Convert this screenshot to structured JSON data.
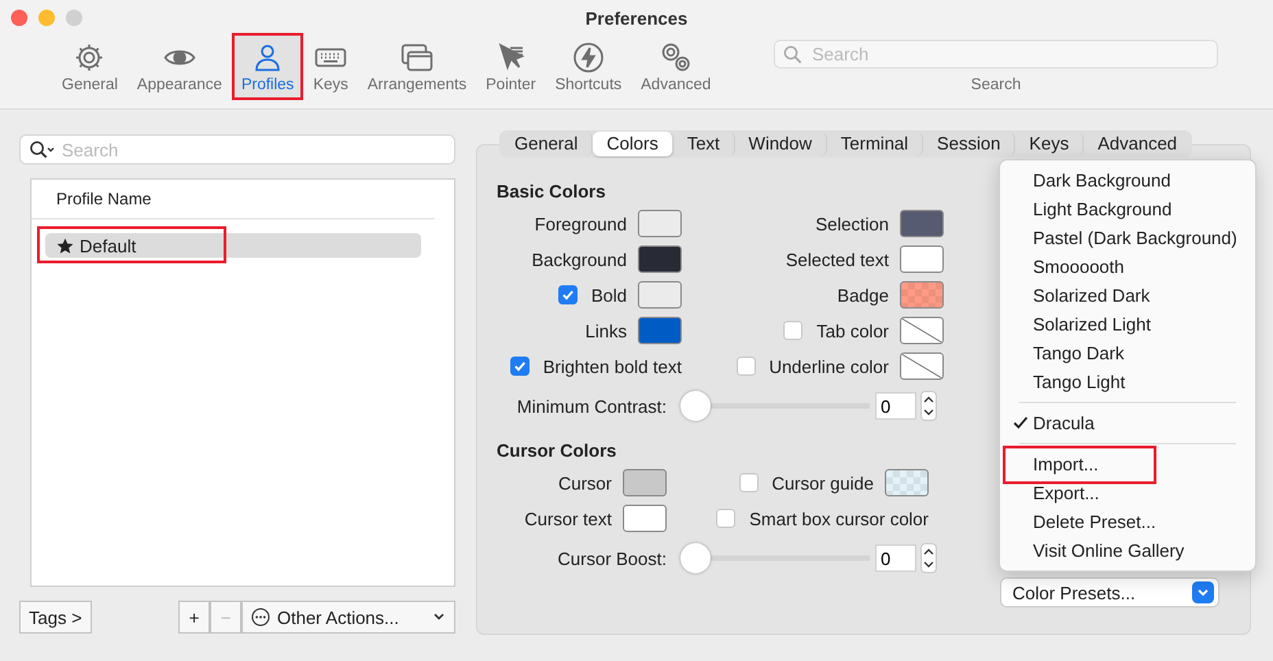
{
  "window": {
    "title": "Preferences"
  },
  "toolbar": [
    {
      "label": "General",
      "selected": false,
      "annotated": false
    },
    {
      "label": "Appearance",
      "selected": false,
      "annotated": false
    },
    {
      "label": "Profiles",
      "selected": true,
      "annotated": true
    },
    {
      "label": "Keys",
      "selected": false,
      "annotated": false
    },
    {
      "label": "Arrangements",
      "selected": false,
      "annotated": false
    },
    {
      "label": "Pointer",
      "selected": false,
      "annotated": false
    },
    {
      "label": "Shortcuts",
      "selected": false,
      "annotated": false
    },
    {
      "label": "Advanced",
      "selected": false,
      "annotated": false
    }
  ],
  "toolbar_search": {
    "placeholder": "Search",
    "label": "Search"
  },
  "profiles": {
    "search": {
      "placeholder": "Search"
    },
    "column": "Profile Name",
    "rows": [
      {
        "label": "Default",
        "is_default": true,
        "selected": true,
        "annotated": true
      }
    ],
    "tags_button": "Tags >",
    "add_button": "+",
    "remove_button": "−",
    "other_actions": "Other Actions..."
  },
  "tabs": [
    {
      "label": "General",
      "selected": false
    },
    {
      "label": "Colors",
      "selected": true
    },
    {
      "label": "Text",
      "selected": false
    },
    {
      "label": "Window",
      "selected": false
    },
    {
      "label": "Terminal",
      "selected": false
    },
    {
      "label": "Session",
      "selected": false
    },
    {
      "label": "Keys",
      "selected": false
    },
    {
      "label": "Advanced",
      "selected": false
    }
  ],
  "basic_colors": {
    "title": "Basic Colors",
    "rows": [
      [
        {
          "label": "Foreground",
          "swatch": {
            "kind": "solid",
            "color": "#ebebeb"
          }
        },
        {
          "label": "Selection",
          "swatch": {
            "kind": "solid",
            "color": "#565b71"
          }
        }
      ],
      [
        {
          "label": "Background",
          "swatch": {
            "kind": "solid",
            "color": "#282a36"
          }
        },
        {
          "label": "Selected text",
          "swatch": {
            "kind": "solid",
            "color": "#ffffff"
          }
        }
      ],
      [
        {
          "label": "Bold",
          "checked": true,
          "swatch": {
            "kind": "solid",
            "color": "#ebebeb"
          }
        },
        {
          "label": "Badge",
          "swatch": {
            "kind": "checker",
            "color": "#ff9b85"
          }
        }
      ],
      [
        {
          "label": "Links",
          "swatch": {
            "kind": "solid",
            "color": "#005cc5"
          }
        },
        {
          "label": "Tab color",
          "checked": false,
          "swatch": {
            "kind": "unset"
          }
        }
      ],
      [
        {
          "label": "Brighten bold text",
          "checked": true
        },
        {
          "label": "Underline color",
          "checked": false,
          "swatch": {
            "kind": "unset"
          }
        }
      ]
    ],
    "slider": {
      "label": "Minimum Contrast:",
      "level": 0,
      "value": "0"
    }
  },
  "cursor_colors": {
    "title": "Cursor Colors",
    "rows": [
      [
        {
          "label": "Cursor",
          "swatch": {
            "kind": "solid",
            "color": "#c8c8c8"
          }
        },
        {
          "label": "Cursor guide",
          "checked": false,
          "swatch": {
            "kind": "checker",
            "color": "#e3f1f8"
          }
        }
      ],
      [
        {
          "label": "Cursor text",
          "swatch": {
            "kind": "solid",
            "color": "#ffffff"
          }
        },
        {
          "label": "Smart box cursor color",
          "checked": false
        }
      ]
    ],
    "slider": {
      "label": "Cursor Boost:",
      "level": 0,
      "value": "0"
    }
  },
  "presets_menu": [
    {
      "kind": "item",
      "label": "Dark Background",
      "checked": false,
      "annotated": false
    },
    {
      "kind": "item",
      "label": "Light Background",
      "checked": false,
      "annotated": false
    },
    {
      "kind": "item",
      "label": "Pastel (Dark Background)",
      "checked": false,
      "annotated": false
    },
    {
      "kind": "item",
      "label": "Smoooooth",
      "checked": false,
      "annotated": false
    },
    {
      "kind": "item",
      "label": "Solarized Dark",
      "checked": false,
      "annotated": false
    },
    {
      "kind": "item",
      "label": "Solarized Light",
      "checked": false,
      "annotated": false
    },
    {
      "kind": "item",
      "label": "Tango Dark",
      "checked": false,
      "annotated": false
    },
    {
      "kind": "item",
      "label": "Tango Light",
      "checked": false,
      "annotated": false
    },
    {
      "kind": "separator"
    },
    {
      "kind": "item",
      "label": "Dracula",
      "checked": true,
      "annotated": false
    },
    {
      "kind": "separator"
    },
    {
      "kind": "item",
      "label": "Import...",
      "checked": false,
      "annotated": true
    },
    {
      "kind": "item",
      "label": "Export...",
      "checked": false,
      "annotated": false
    },
    {
      "kind": "item",
      "label": "Delete Preset...",
      "checked": false,
      "annotated": false
    },
    {
      "kind": "item",
      "label": "Visit Online Gallery",
      "checked": false,
      "annotated": false
    }
  ],
  "presets_button": "Color Presets..."
}
